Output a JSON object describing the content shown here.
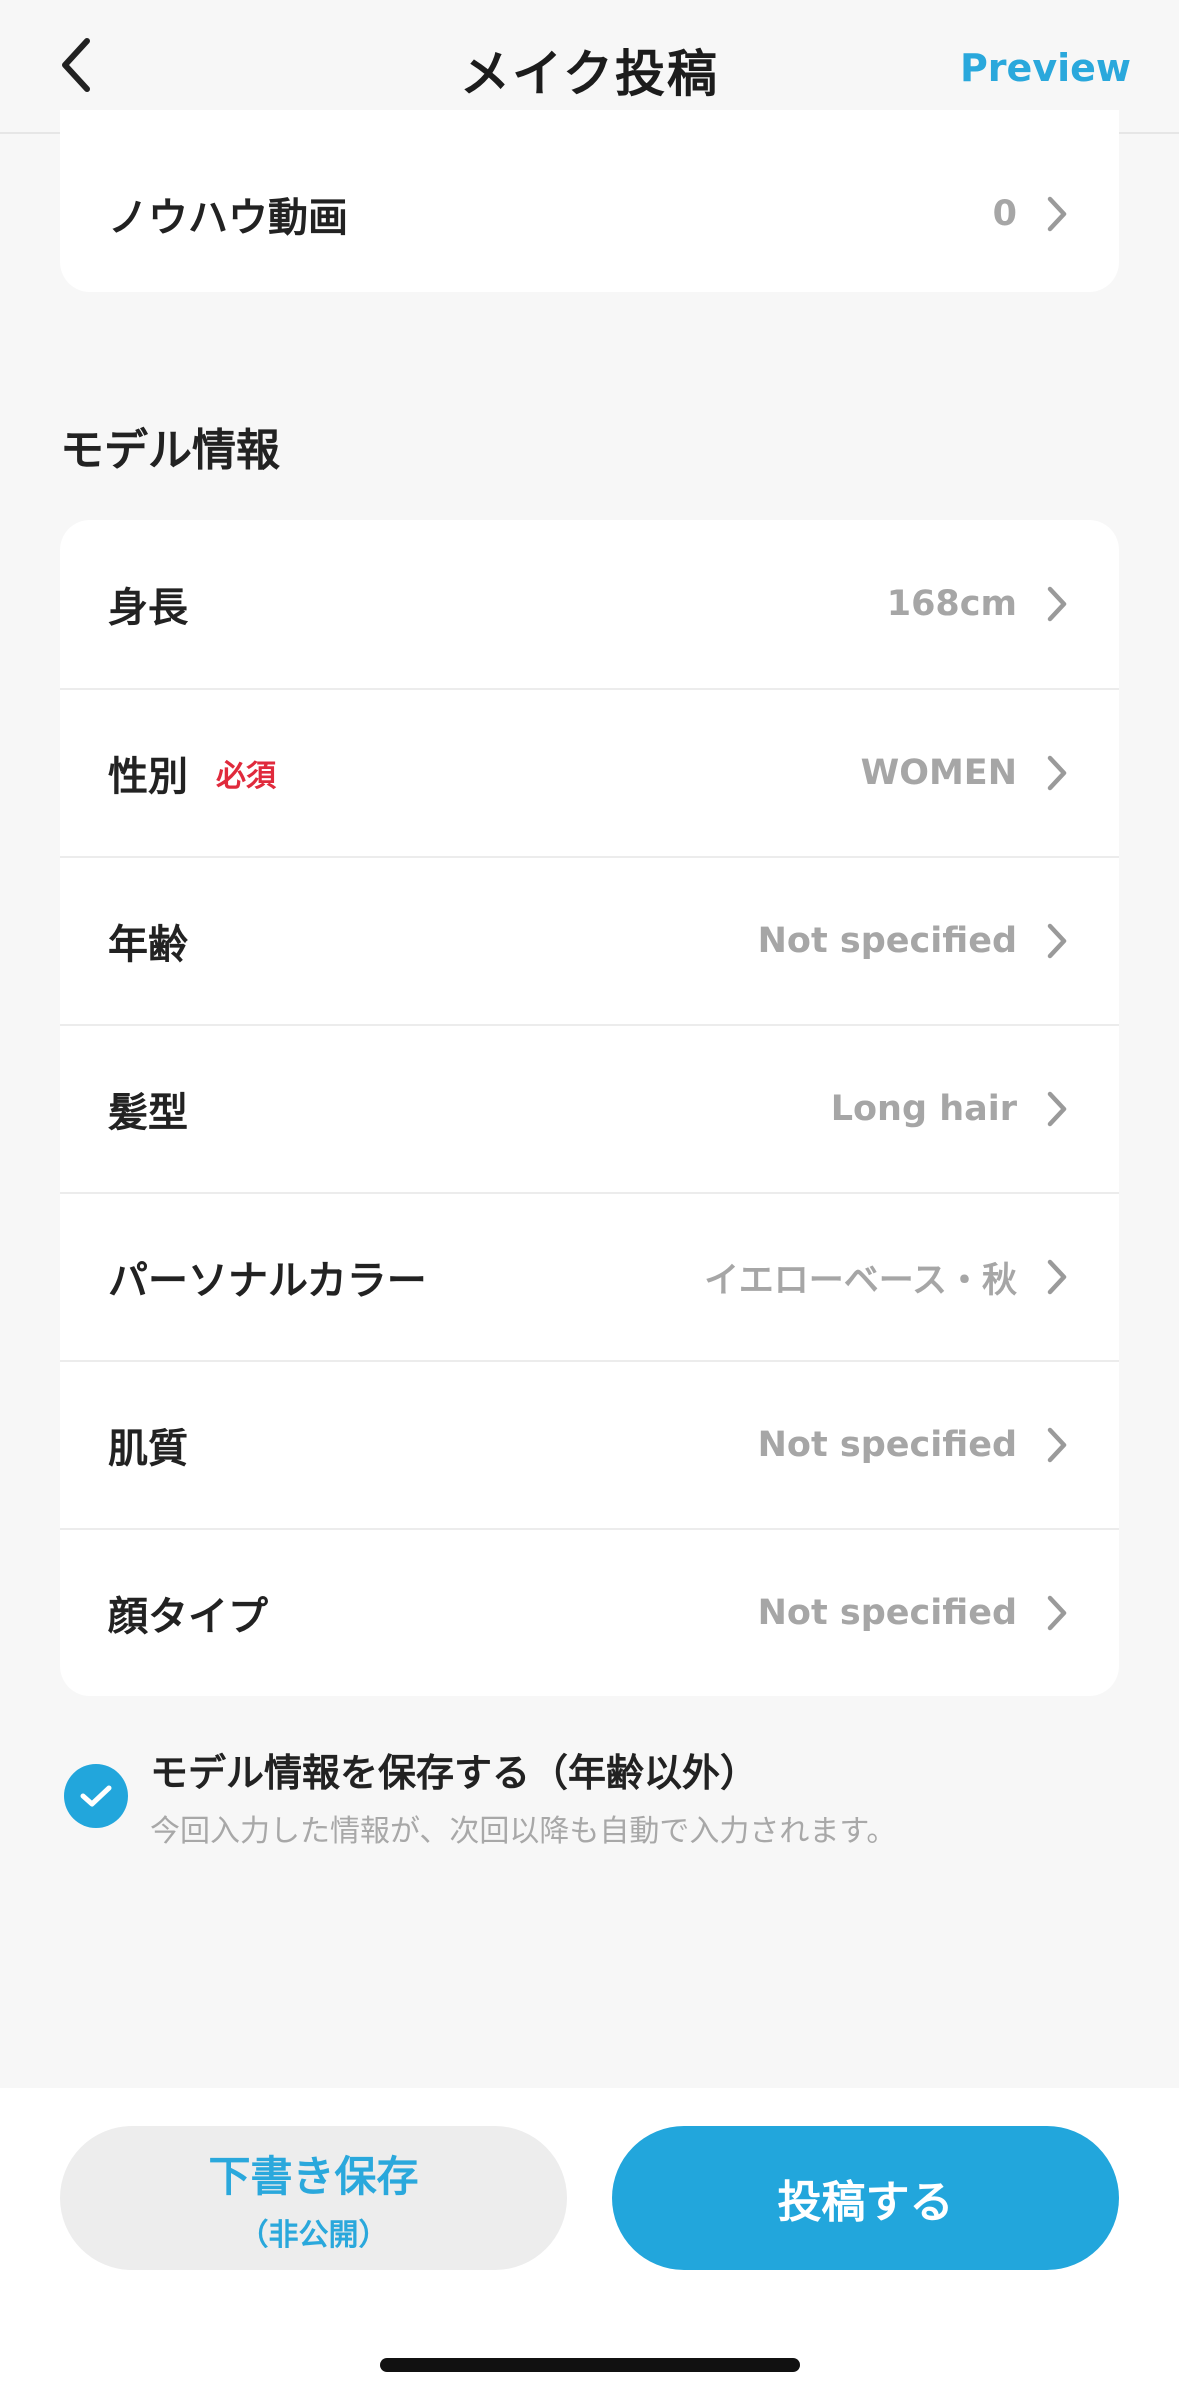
{
  "header": {
    "title": "メイク投稿",
    "preview_label": "Preview"
  },
  "top_card": {
    "label": "ノウハウ動画",
    "value": "0"
  },
  "model_section": {
    "title": "モデル情報",
    "rows": [
      {
        "label": "身長",
        "value": "168cm",
        "badge": ""
      },
      {
        "label": "性別",
        "value": "WOMEN",
        "badge": "必須"
      },
      {
        "label": "年齢",
        "value": "Not specified",
        "badge": ""
      },
      {
        "label": "髪型",
        "value": "Long hair",
        "badge": ""
      },
      {
        "label": "パーソナルカラー",
        "value": "イエローベース・秋",
        "badge": ""
      },
      {
        "label": "肌質",
        "value": "Not specified",
        "badge": ""
      },
      {
        "label": "顔タイプ",
        "value": "Not specified",
        "badge": ""
      }
    ]
  },
  "save_option": {
    "checked": true,
    "title": "モデル情報を保存する（年齢以外）",
    "note": "今回入力した情報が、次回以降も自動で入力されます。"
  },
  "bottom_bar": {
    "draft_label": "下書き保存",
    "draft_sublabel": "（非公開）",
    "post_label": "投稿する"
  },
  "colors": {
    "accent": "#22a6dc",
    "required": "#e02a3c",
    "value_text": "#a6a6a6"
  }
}
